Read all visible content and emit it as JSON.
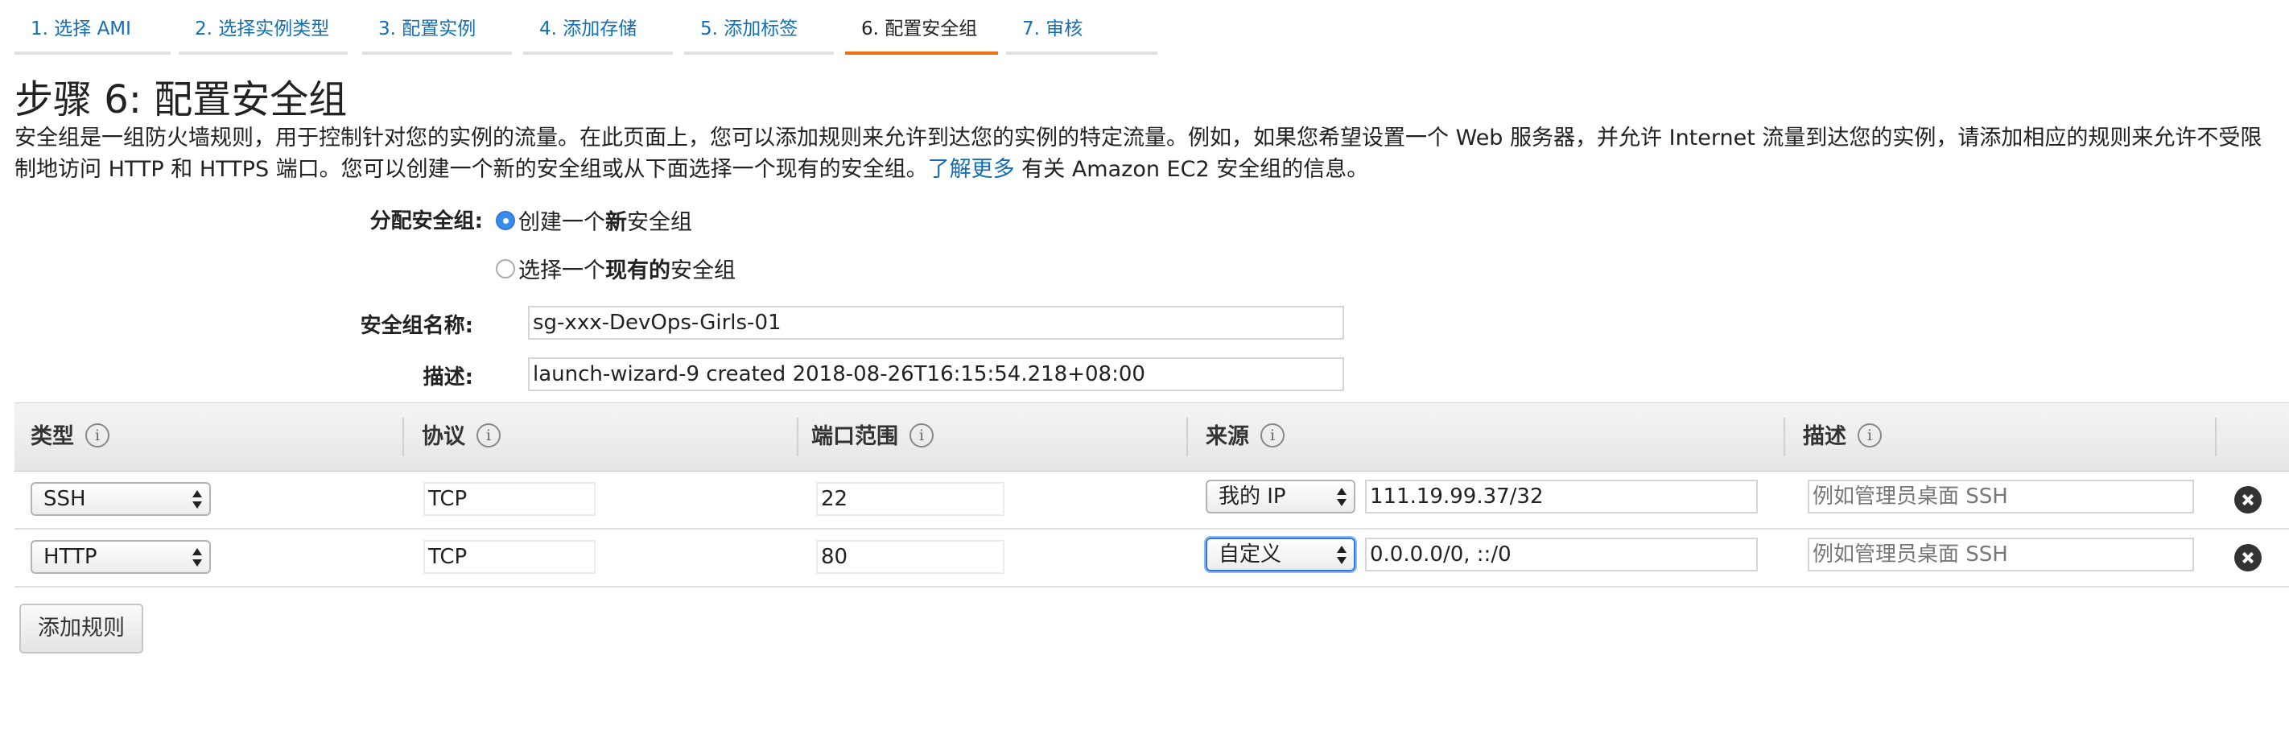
{
  "steps": [
    {
      "label": "1. 选择 AMI"
    },
    {
      "label": "2. 选择实例类型"
    },
    {
      "label": "3. 配置实例"
    },
    {
      "label": "4. 添加存储"
    },
    {
      "label": "5. 添加标签"
    },
    {
      "label": "6. 配置安全组",
      "active": true
    },
    {
      "label": "7. 审核"
    }
  ],
  "page": {
    "title": "步骤 6: 配置安全组",
    "intro_text": "安全组是一组防火墙规则，用于控制针对您的实例的流量。在此页面上，您可以添加规则来允许到达您的实例的特定流量。例如，如果您希望设置一个 Web 服务器，并允许 Internet 流量到达您的实例，请添加相应的规则来允许不受限制地访问 HTTP 和 HTTPS 端口。您可以创建一个新的安全组或从下面选择一个现有的安全组。",
    "learn_more": "了解更多",
    "intro_suffix": " 有关 Amazon EC2 安全组的信息。"
  },
  "form": {
    "assign_label": "分配安全组:",
    "option_new": {
      "prefix": "创建一个",
      "bold": "新",
      "suffix": "安全组",
      "selected": true
    },
    "option_existing": {
      "prefix": "选择一个",
      "bold": "现有的",
      "suffix": "安全组",
      "selected": false
    },
    "name_label": "安全组名称:",
    "name_value": "sg-xxx-DevOps-Girls-01",
    "desc_label": "描述:",
    "desc_value": "launch-wizard-9 created 2018-08-26T16:15:54.218+08:00"
  },
  "table": {
    "headers": {
      "type": "类型",
      "protocol": "协议",
      "port_range": "端口范围",
      "source": "来源",
      "description": "描述"
    },
    "info_glyph": "i",
    "rows": [
      {
        "type": "SSH",
        "protocol": "TCP",
        "port": "22",
        "source_type": "我的 IP",
        "source_value": "111.19.99.37/32",
        "desc_placeholder": "例如管理员桌面 SSH",
        "desc_value": ""
      },
      {
        "type": "HTTP",
        "protocol": "TCP",
        "port": "80",
        "source_type": "自定义",
        "source_value": "0.0.0.0/0, ::/0",
        "desc_placeholder": "例如管理员桌面 SSH",
        "desc_value": ""
      }
    ]
  },
  "add_rule_label": "添加规则",
  "colors": {
    "link": "#146eb4",
    "active_tab": "#ec7211",
    "radio": "#3b8bea"
  }
}
